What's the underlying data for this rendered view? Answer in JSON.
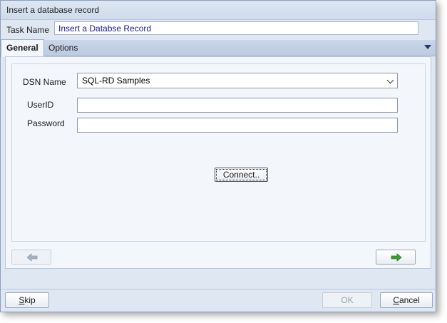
{
  "window": {
    "title": "Insert a database record"
  },
  "task": {
    "label": "Task Name",
    "value": "Insert a Databse Record"
  },
  "tabs": [
    {
      "label": "General",
      "active": true
    },
    {
      "label": "Options",
      "active": false
    }
  ],
  "form": {
    "dsn_label": "DSN Name",
    "dsn_value": "SQL-RD Samples",
    "userid_label": "UserID",
    "userid_value": "",
    "password_label": "Password",
    "password_value": "",
    "connect_label": "Connect.."
  },
  "footer": {
    "skip_mnemonic": "S",
    "skip_rest": "kip",
    "ok_label": "OK",
    "cancel_mnemonic": "C",
    "cancel_rest": "ancel"
  },
  "colors": {
    "arrow_back": "#a9b4c3",
    "arrow_next": "#3aa02c"
  },
  "icons": {
    "back": "left-arrow-icon",
    "next": "right-arrow-icon",
    "tab_menu": "dropdown-triangle-icon",
    "select": "chevron-down-icon"
  }
}
